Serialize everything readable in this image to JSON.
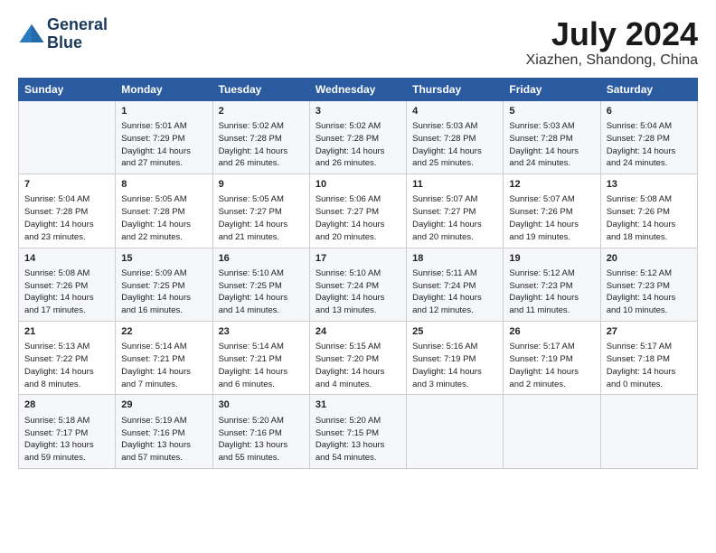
{
  "header": {
    "logo_line1": "General",
    "logo_line2": "Blue",
    "title": "July 2024",
    "subtitle": "Xiazhen, Shandong, China"
  },
  "calendar": {
    "days_of_week": [
      "Sunday",
      "Monday",
      "Tuesday",
      "Wednesday",
      "Thursday",
      "Friday",
      "Saturday"
    ],
    "weeks": [
      [
        {
          "day": "",
          "info": ""
        },
        {
          "day": "1",
          "info": "Sunrise: 5:01 AM\nSunset: 7:29 PM\nDaylight: 14 hours\nand 27 minutes."
        },
        {
          "day": "2",
          "info": "Sunrise: 5:02 AM\nSunset: 7:28 PM\nDaylight: 14 hours\nand 26 minutes."
        },
        {
          "day": "3",
          "info": "Sunrise: 5:02 AM\nSunset: 7:28 PM\nDaylight: 14 hours\nand 26 minutes."
        },
        {
          "day": "4",
          "info": "Sunrise: 5:03 AM\nSunset: 7:28 PM\nDaylight: 14 hours\nand 25 minutes."
        },
        {
          "day": "5",
          "info": "Sunrise: 5:03 AM\nSunset: 7:28 PM\nDaylight: 14 hours\nand 24 minutes."
        },
        {
          "day": "6",
          "info": "Sunrise: 5:04 AM\nSunset: 7:28 PM\nDaylight: 14 hours\nand 24 minutes."
        }
      ],
      [
        {
          "day": "7",
          "info": "Sunrise: 5:04 AM\nSunset: 7:28 PM\nDaylight: 14 hours\nand 23 minutes."
        },
        {
          "day": "8",
          "info": "Sunrise: 5:05 AM\nSunset: 7:28 PM\nDaylight: 14 hours\nand 22 minutes."
        },
        {
          "day": "9",
          "info": "Sunrise: 5:05 AM\nSunset: 7:27 PM\nDaylight: 14 hours\nand 21 minutes."
        },
        {
          "day": "10",
          "info": "Sunrise: 5:06 AM\nSunset: 7:27 PM\nDaylight: 14 hours\nand 20 minutes."
        },
        {
          "day": "11",
          "info": "Sunrise: 5:07 AM\nSunset: 7:27 PM\nDaylight: 14 hours\nand 20 minutes."
        },
        {
          "day": "12",
          "info": "Sunrise: 5:07 AM\nSunset: 7:26 PM\nDaylight: 14 hours\nand 19 minutes."
        },
        {
          "day": "13",
          "info": "Sunrise: 5:08 AM\nSunset: 7:26 PM\nDaylight: 14 hours\nand 18 minutes."
        }
      ],
      [
        {
          "day": "14",
          "info": "Sunrise: 5:08 AM\nSunset: 7:26 PM\nDaylight: 14 hours\nand 17 minutes."
        },
        {
          "day": "15",
          "info": "Sunrise: 5:09 AM\nSunset: 7:25 PM\nDaylight: 14 hours\nand 16 minutes."
        },
        {
          "day": "16",
          "info": "Sunrise: 5:10 AM\nSunset: 7:25 PM\nDaylight: 14 hours\nand 14 minutes."
        },
        {
          "day": "17",
          "info": "Sunrise: 5:10 AM\nSunset: 7:24 PM\nDaylight: 14 hours\nand 13 minutes."
        },
        {
          "day": "18",
          "info": "Sunrise: 5:11 AM\nSunset: 7:24 PM\nDaylight: 14 hours\nand 12 minutes."
        },
        {
          "day": "19",
          "info": "Sunrise: 5:12 AM\nSunset: 7:23 PM\nDaylight: 14 hours\nand 11 minutes."
        },
        {
          "day": "20",
          "info": "Sunrise: 5:12 AM\nSunset: 7:23 PM\nDaylight: 14 hours\nand 10 minutes."
        }
      ],
      [
        {
          "day": "21",
          "info": "Sunrise: 5:13 AM\nSunset: 7:22 PM\nDaylight: 14 hours\nand 8 minutes."
        },
        {
          "day": "22",
          "info": "Sunrise: 5:14 AM\nSunset: 7:21 PM\nDaylight: 14 hours\nand 7 minutes."
        },
        {
          "day": "23",
          "info": "Sunrise: 5:14 AM\nSunset: 7:21 PM\nDaylight: 14 hours\nand 6 minutes."
        },
        {
          "day": "24",
          "info": "Sunrise: 5:15 AM\nSunset: 7:20 PM\nDaylight: 14 hours\nand 4 minutes."
        },
        {
          "day": "25",
          "info": "Sunrise: 5:16 AM\nSunset: 7:19 PM\nDaylight: 14 hours\nand 3 minutes."
        },
        {
          "day": "26",
          "info": "Sunrise: 5:17 AM\nSunset: 7:19 PM\nDaylight: 14 hours\nand 2 minutes."
        },
        {
          "day": "27",
          "info": "Sunrise: 5:17 AM\nSunset: 7:18 PM\nDaylight: 14 hours\nand 0 minutes."
        }
      ],
      [
        {
          "day": "28",
          "info": "Sunrise: 5:18 AM\nSunset: 7:17 PM\nDaylight: 13 hours\nand 59 minutes."
        },
        {
          "day": "29",
          "info": "Sunrise: 5:19 AM\nSunset: 7:16 PM\nDaylight: 13 hours\nand 57 minutes."
        },
        {
          "day": "30",
          "info": "Sunrise: 5:20 AM\nSunset: 7:16 PM\nDaylight: 13 hours\nand 55 minutes."
        },
        {
          "day": "31",
          "info": "Sunrise: 5:20 AM\nSunset: 7:15 PM\nDaylight: 13 hours\nand 54 minutes."
        },
        {
          "day": "",
          "info": ""
        },
        {
          "day": "",
          "info": ""
        },
        {
          "day": "",
          "info": ""
        }
      ]
    ]
  }
}
